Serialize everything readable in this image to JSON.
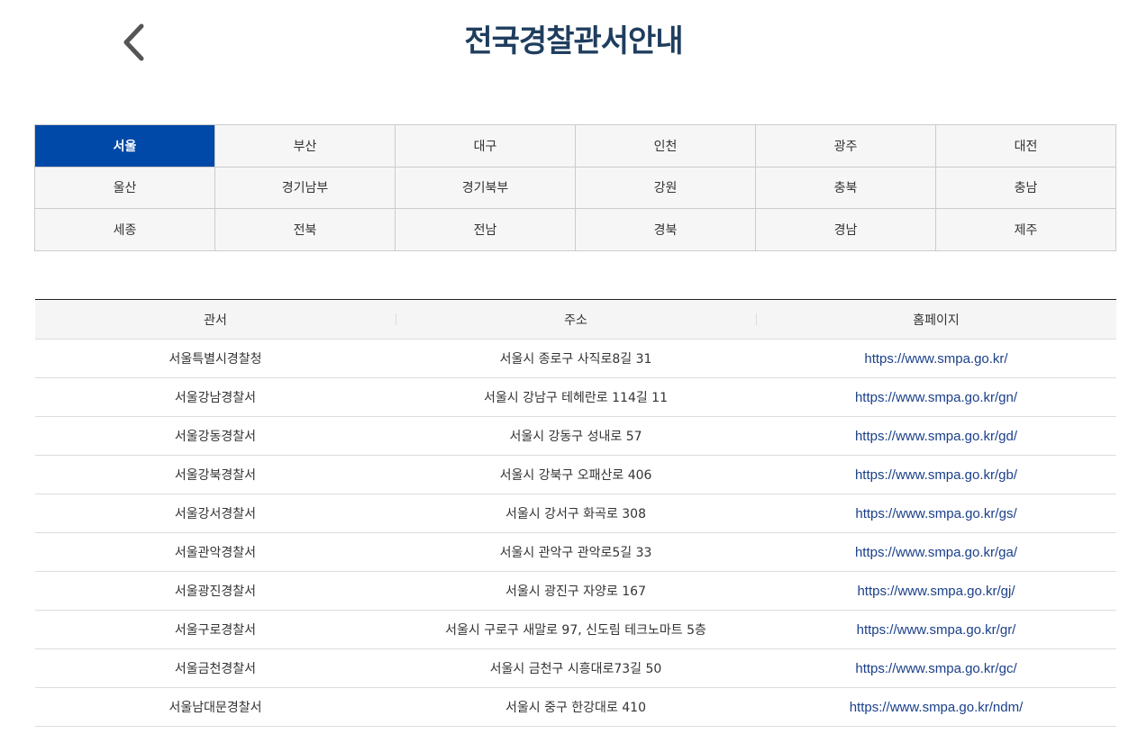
{
  "header": {
    "title": "전국경찰관서안내",
    "back_icon": "chevron-left-icon"
  },
  "colors": {
    "title": "#1f3d5e",
    "active_tab": "#0049a8",
    "link": "#1a3f8a"
  },
  "regions": [
    {
      "label": "서울",
      "active": true
    },
    {
      "label": "부산",
      "active": false
    },
    {
      "label": "대구",
      "active": false
    },
    {
      "label": "인천",
      "active": false
    },
    {
      "label": "광주",
      "active": false
    },
    {
      "label": "대전",
      "active": false
    },
    {
      "label": "울산",
      "active": false
    },
    {
      "label": "경기남부",
      "active": false
    },
    {
      "label": "경기북부",
      "active": false
    },
    {
      "label": "강원",
      "active": false
    },
    {
      "label": "충북",
      "active": false
    },
    {
      "label": "충남",
      "active": false
    },
    {
      "label": "세종",
      "active": false
    },
    {
      "label": "전북",
      "active": false
    },
    {
      "label": "전남",
      "active": false
    },
    {
      "label": "경북",
      "active": false
    },
    {
      "label": "경남",
      "active": false
    },
    {
      "label": "제주",
      "active": false
    }
  ],
  "table": {
    "headers": [
      "관서",
      "주소",
      "홈페이지"
    ],
    "rows": [
      {
        "name": "서울특별시경찰청",
        "address": "서울시 종로구 사직로8길 31",
        "homepage": "https://www.smpa.go.kr/"
      },
      {
        "name": "서울강남경찰서",
        "address": "서울시 강남구 테헤란로 114길 11",
        "homepage": "https://www.smpa.go.kr/gn/"
      },
      {
        "name": "서울강동경찰서",
        "address": "서울시 강동구 성내로 57",
        "homepage": "https://www.smpa.go.kr/gd/"
      },
      {
        "name": "서울강북경찰서",
        "address": "서울시 강북구 오패산로 406",
        "homepage": "https://www.smpa.go.kr/gb/"
      },
      {
        "name": "서울강서경찰서",
        "address": "서울시 강서구 화곡로 308",
        "homepage": "https://www.smpa.go.kr/gs/"
      },
      {
        "name": "서울관악경찰서",
        "address": "서울시 관악구 관악로5길 33",
        "homepage": "https://www.smpa.go.kr/ga/"
      },
      {
        "name": "서울광진경찰서",
        "address": "서울시 광진구 자양로 167",
        "homepage": "https://www.smpa.go.kr/gj/"
      },
      {
        "name": "서울구로경찰서",
        "address": "서울시 구로구 새말로 97, 신도림 테크노마트 5층",
        "homepage": "https://www.smpa.go.kr/gr/"
      },
      {
        "name": "서울금천경찰서",
        "address": "서울시 금천구 시흥대로73길 50",
        "homepage": "https://www.smpa.go.kr/gc/"
      },
      {
        "name": "서울남대문경찰서",
        "address": "서울시 중구 한강대로 410",
        "homepage": "https://www.smpa.go.kr/ndm/"
      }
    ]
  }
}
